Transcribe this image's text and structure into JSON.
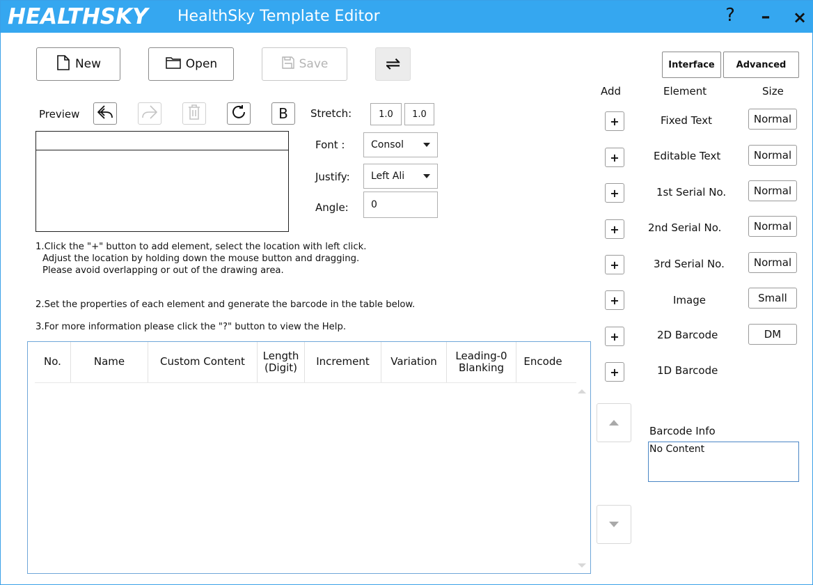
{
  "titlebar": {
    "logo": "HEALTHSKY",
    "title": "HealthSky Template Editor",
    "help": "?",
    "minimize": "–",
    "close": "×"
  },
  "toolbar": {
    "new_label": "New",
    "open_label": "Open",
    "save_label": "Save",
    "swap_symbol": "⇌"
  },
  "tabs": {
    "interface": "Interface",
    "advanced": "Advanced"
  },
  "preview": {
    "label": "Preview",
    "bold_label": "B"
  },
  "properties": {
    "stretch_label": "Stretch:",
    "stretch_x": "1.0",
    "stretch_y": "1.0",
    "font_label": "Font :",
    "font_value": "Consol",
    "justify_label": "Justify:",
    "justify_value": "Left Ali",
    "angle_label": "Angle:",
    "angle_value": "0"
  },
  "instructions": {
    "line1": "1.Click the \"+\" button to add element, select the location with left click.",
    "line2": "Adjust the location by holding down the mouse button and dragging.",
    "line3": "Please avoid overlapping or out of the drawing area.",
    "line4": "2.Set the properties of each element and generate the barcode in the table below.",
    "line5": "3.For more information please click the \"?\" button to view the Help."
  },
  "table": {
    "columns": [
      {
        "label": "No."
      },
      {
        "label": "Name"
      },
      {
        "label": "Custom Content"
      },
      {
        "label": "Length\n(Digit)"
      },
      {
        "label": "Increment"
      },
      {
        "label": "Variation"
      },
      {
        "label": "Leading-0\nBlanking"
      },
      {
        "label": "Encode"
      }
    ]
  },
  "elements_panel": {
    "header_add": "Add",
    "header_element": "Element",
    "header_size": "Size",
    "plus": "+",
    "items": [
      {
        "label": "Fixed Text",
        "size": "Normal"
      },
      {
        "label": "Editable Text",
        "size": "Normal"
      },
      {
        "label": "1st Serial No.",
        "size": "Normal"
      },
      {
        "label": "2nd Serial No.",
        "size": "Normal"
      },
      {
        "label": "3rd Serial No.",
        "size": "Normal"
      },
      {
        "label": "Image",
        "size": "Small"
      },
      {
        "label": "2D Barcode",
        "size": "DM"
      },
      {
        "label": "1D Barcode",
        "size": ""
      }
    ]
  },
  "barcode_info": {
    "label": "Barcode Info",
    "content": "No Content"
  }
}
